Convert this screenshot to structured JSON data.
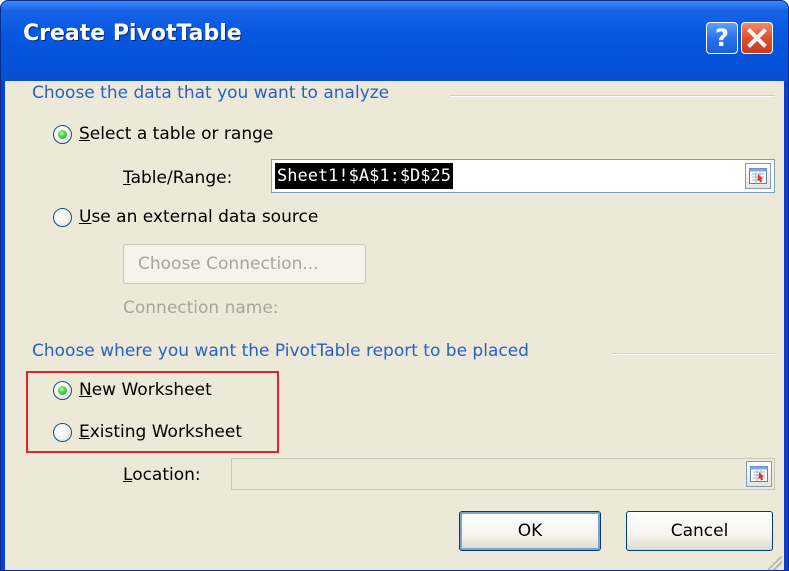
{
  "window": {
    "title": "Create PivotTable",
    "help_label": "?",
    "close_label": "×"
  },
  "section1": {
    "heading": "Choose the data that you want to analyze",
    "option_table": {
      "accel": "S",
      "rest": "elect a table or range",
      "checked": true
    },
    "table_range": {
      "accel": "T",
      "rest": "able/Range:",
      "value": "Sheet1!$A$1:$D$25"
    },
    "option_external": {
      "accel": "U",
      "rest": "se an external data source",
      "checked": false
    },
    "choose_connection_label": "Choose Connection...",
    "connection_name_label": "Connection name:"
  },
  "section2": {
    "heading": "Choose where you want the PivotTable report to be placed",
    "option_new": {
      "accel": "N",
      "rest": "ew Worksheet",
      "checked": true
    },
    "option_existing": {
      "accel": "E",
      "rest": "xisting Worksheet",
      "checked": false
    },
    "location": {
      "accel": "L",
      "rest": "ocation:",
      "value": ""
    }
  },
  "buttons": {
    "ok_label": "OK",
    "cancel_label": "Cancel"
  },
  "colors": {
    "titlebar": "#0552d8",
    "section_heading": "#2a5fc4",
    "highlight_box": "#e8222b",
    "radio_checked": "#3ec63e"
  },
  "icons": [
    "help-icon",
    "close-icon",
    "collapse-dialog-icon",
    "resize-grip-icon"
  ]
}
